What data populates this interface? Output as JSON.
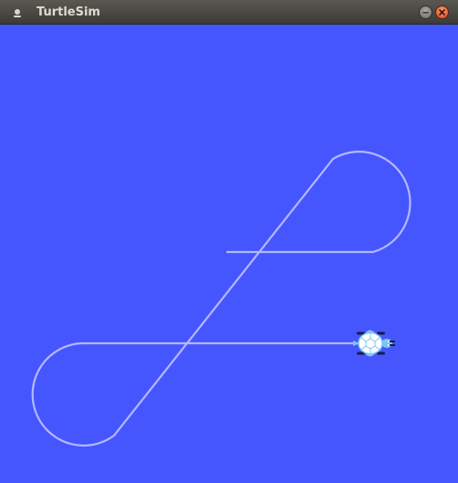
{
  "window": {
    "title": "TurtleSim",
    "background_color": "#4556ff",
    "pen_color": "#b3b8ff",
    "icons": {
      "app": "turtle-app-icon",
      "minimize": "minimize-icon",
      "close": "close-icon"
    }
  },
  "turtle": {
    "name": "turtle-icon",
    "heading": "east"
  }
}
